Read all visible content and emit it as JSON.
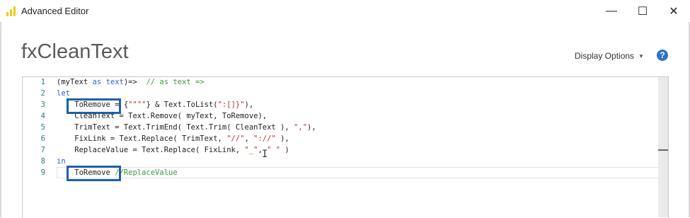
{
  "window": {
    "title": "Advanced Editor",
    "minimize": "—",
    "maximize": "☐",
    "close": "✕"
  },
  "header": {
    "query_name": "fxCleanText",
    "display_options": "Display Options",
    "help": "?"
  },
  "editor": {
    "lines": [
      {
        "num": "1",
        "parts": [
          {
            "t": "(myText ",
            "c": ""
          },
          {
            "t": "as",
            "c": "kw"
          },
          {
            "t": " ",
            "c": ""
          },
          {
            "t": "text",
            "c": "kw"
          },
          {
            "t": ")=>  ",
            "c": ""
          },
          {
            "t": "// as text =>",
            "c": "cm"
          }
        ]
      },
      {
        "num": "2",
        "parts": [
          {
            "t": "let",
            "c": "kw"
          }
        ]
      },
      {
        "num": "3",
        "parts": [
          {
            "t": "    ToRemove = {",
            "c": ""
          },
          {
            "t": "\"\"\"\"",
            "c": "str"
          },
          {
            "t": "} & Text.ToList(",
            "c": ""
          },
          {
            "t": "\":[]}\"",
            "c": "str"
          },
          {
            "t": "),",
            "c": ""
          }
        ]
      },
      {
        "num": "4",
        "parts": [
          {
            "t": "    CleanText = Text.Remove( myText, ToRemove),",
            "c": ""
          }
        ]
      },
      {
        "num": "5",
        "parts": [
          {
            "t": "    TrimText = Text.TrimEnd( Text.Trim( CleanText ), ",
            "c": ""
          },
          {
            "t": "\",\"",
            "c": "str"
          },
          {
            "t": "),",
            "c": ""
          }
        ]
      },
      {
        "num": "6",
        "parts": [
          {
            "t": "    FixLink = Text.Replace( TrimText, ",
            "c": ""
          },
          {
            "t": "\"//\"",
            "c": "str"
          },
          {
            "t": ", ",
            "c": ""
          },
          {
            "t": "\"://\"",
            "c": "str"
          },
          {
            "t": " ),",
            "c": ""
          }
        ]
      },
      {
        "num": "7",
        "parts": [
          {
            "t": "    ReplaceValue = Text.Replace( FixLink, ",
            "c": ""
          },
          {
            "t": "\"_\"",
            "c": "str"
          },
          {
            "t": ", ",
            "c": ""
          },
          {
            "t": "\" \"",
            "c": "str"
          },
          {
            "t": " )",
            "c": ""
          }
        ]
      },
      {
        "num": "8",
        "parts": [
          {
            "t": "in",
            "c": "kw"
          }
        ]
      },
      {
        "num": "9",
        "parts": [
          {
            "t": "    ToRemove ",
            "c": ""
          },
          {
            "t": "//ReplaceValue",
            "c": "cm"
          }
        ]
      }
    ]
  },
  "colors": {
    "highlight_border": "#1f5fa8",
    "keyword": "#2b5fd9",
    "comment": "#3a9a3a",
    "string": "#b0302a",
    "line_number": "#2b7a8a"
  }
}
